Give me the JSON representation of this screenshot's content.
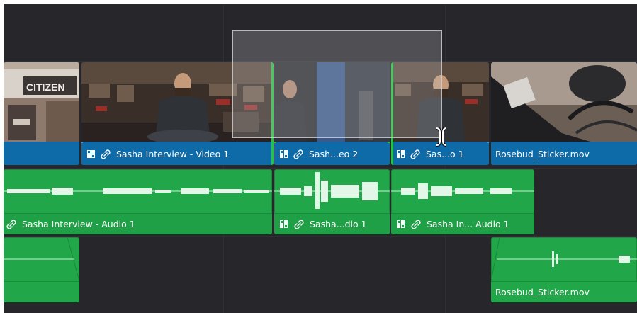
{
  "timeline": {
    "video_track": {
      "clips": [
        {
          "name": "",
          "thumbnail": "citizen-storefront"
        },
        {
          "name": "Sasha Interview - Video 1",
          "thumbnail": "interview-shop"
        },
        {
          "name": "Sash...eo 2",
          "thumbnail": "interview-closeup"
        },
        {
          "name": "Sas...o 1",
          "thumbnail": "interview-shop"
        },
        {
          "name": "Rosebud_Sticker.mov",
          "thumbnail": "bike-frame-sticker"
        }
      ],
      "thumbnail_text": {
        "sign": "CITIZEN"
      }
    },
    "audio_track_1": {
      "clips": [
        {
          "name": "Sasha Interview - Audio 1"
        },
        {
          "name": "Sasha...dio 1"
        },
        {
          "name": "Sasha In... Audio 1"
        }
      ]
    },
    "audio_track_2": {
      "clips": [
        {
          "name": ""
        },
        {
          "name": "Rosebud_Sticker.mov"
        }
      ]
    },
    "icons": {
      "link": "link-icon",
      "multicam": "clip-badge-icon",
      "trim": "trim-cursor-icon"
    },
    "colors": {
      "background": "#26262b",
      "video_clip": "#0f6aa8",
      "audio_clip": "#22a64a",
      "selection_green": "#23c43f",
      "selection_blue": "#3b9de0"
    }
  }
}
